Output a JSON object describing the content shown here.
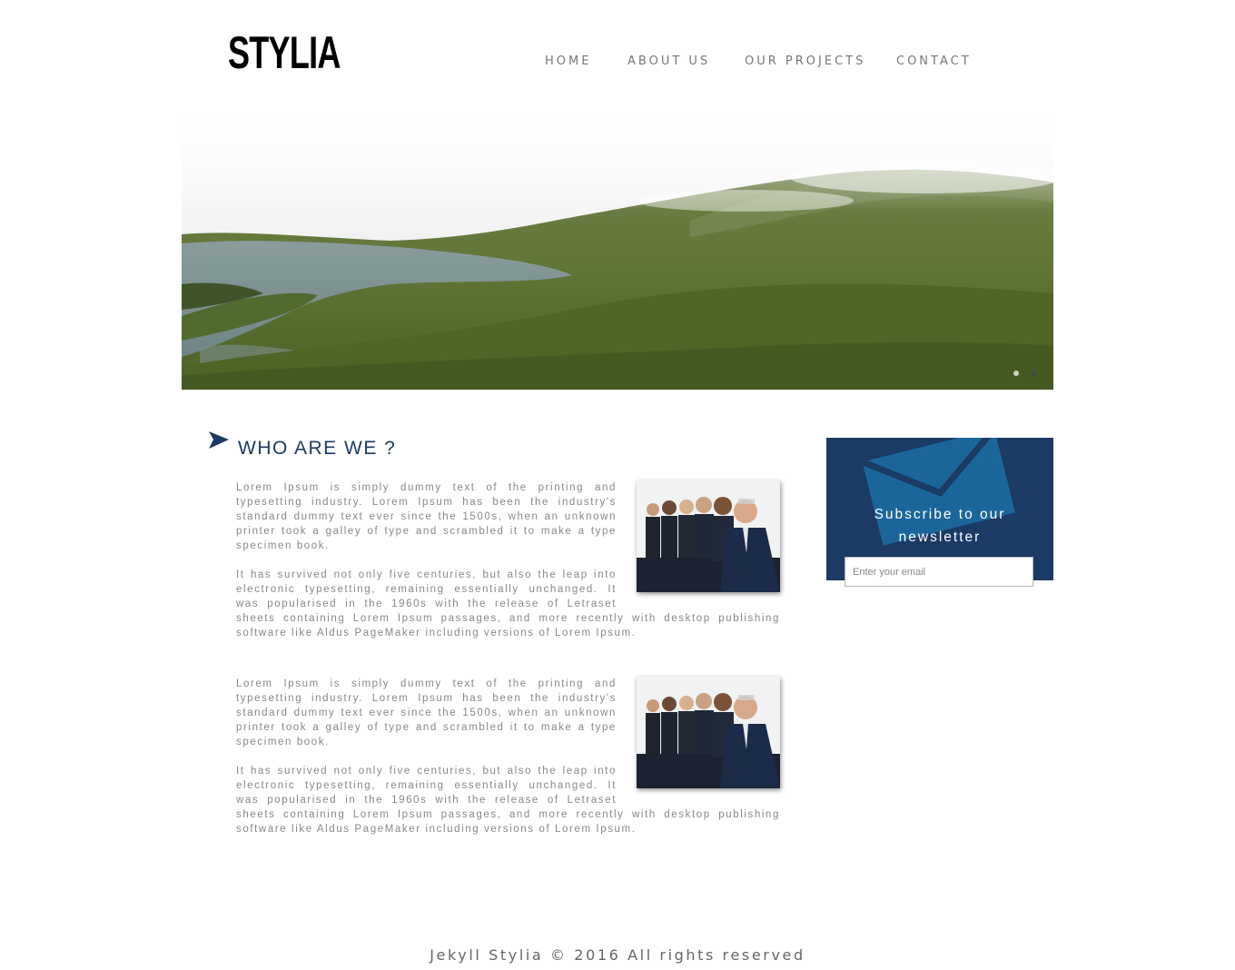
{
  "site": {
    "logo": "STYLIA"
  },
  "nav": {
    "items": [
      {
        "label": "HOME",
        "name": "nav-home"
      },
      {
        "label": "ABOUT US",
        "name": "nav-about-us"
      },
      {
        "label": "OUR PROJECTS",
        "name": "nav-our-projects"
      },
      {
        "label": "CONTACT",
        "name": "nav-contact"
      }
    ]
  },
  "slider": {
    "slide_count": 2,
    "active_index": 1
  },
  "about": {
    "icon": "arrow-icon",
    "heading": "WHO ARE WE ?",
    "articles": [
      {
        "image": "business-team-photo",
        "paragraphs": [
          "Lorem Ipsum is simply dummy text of the printing and typesetting industry. Lorem Ipsum has been the industry's standard dummy text ever since the 1500s, when an unknown printer took a galley of type and scrambled it to make a type specimen book.",
          "It has survived not only five centuries, but also the leap into electronic typesetting, remaining essentially unchanged. It was popularised in the 1960s with the release of Letraset sheets containing Lorem Ipsum passages, and more recently with desktop publishing software like Aldus PageMaker including versions of Lorem Ipsum."
        ]
      },
      {
        "image": "business-team-photo",
        "paragraphs": [
          "Lorem Ipsum is simply dummy text of the printing and typesetting industry. Lorem Ipsum has been the industry's standard dummy text ever since the 1500s, when an unknown printer took a galley of type and scrambled it to make a type specimen book.",
          "It has survived not only five centuries, but also the leap into electronic typesetting, remaining essentially unchanged. It was popularised in the 1960s with the release of Letraset sheets containing Lorem Ipsum passages, and more recently with desktop publishing software like Aldus PageMaker including versions of Lorem Ipsum."
        ]
      }
    ]
  },
  "newsletter": {
    "icon": "envelope-icon",
    "title_line1": "Subscribe to our",
    "title_line2": "newsletter",
    "email_placeholder": "Enter your email"
  },
  "footer": {
    "text": "Jekyll Stylia © 2016 All rights reserved"
  },
  "colors": {
    "accent": "#1b3a64",
    "heading": "#1e3a63",
    "body_text": "#888888",
    "nav_text": "#777777"
  }
}
